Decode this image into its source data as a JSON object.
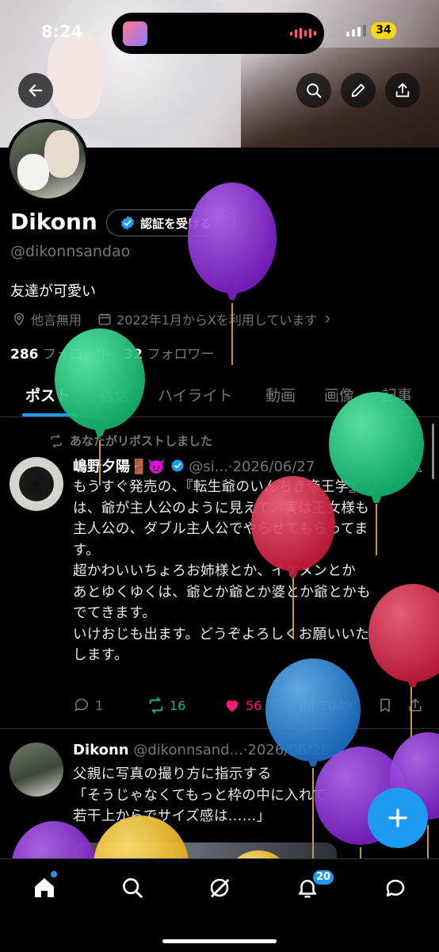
{
  "status_bar": {
    "time": "8:24",
    "battery": "34"
  },
  "profile": {
    "name": "Dikonn",
    "verify_label": "認証を受ける",
    "handle": "@dikonnsandao",
    "bio": "友達が可愛い",
    "location": "他言無用",
    "joined": "2022年1月からXを利用しています",
    "following_count": "286",
    "following_label": "フォロー中",
    "followers_count": "32",
    "followers_label": "フォロワー"
  },
  "tabs": [
    {
      "label": "ポスト"
    },
    {
      "label": "返信"
    },
    {
      "label": "ハイライト"
    },
    {
      "label": "動画"
    },
    {
      "label": "画像"
    },
    {
      "label": "記事"
    }
  ],
  "posts": [
    {
      "repost_text": "あなたがリポストしました",
      "author": "嶋野夕陽🚪👿",
      "handle": "@si...",
      "date": "·2026/06/27",
      "lines": [
        "もうすぐ発売の、『転生爺のいんちき帝王学』",
        "は、爺が主人公のように見えて、実は王女様も",
        "主人公の、ダブル主人公でやらせてもらってま",
        "す。",
        "超かわいいちょろお姉様とか、イケメンとか",
        "あとゆくゆくは、爺とか爺とか婆とか爺とかも",
        "でてきます。",
        "いけおじも出ます。どうぞよろしくお願いいた",
        "します。"
      ],
      "replies": "1",
      "reposts": "16",
      "likes": "56",
      "views": "3049"
    },
    {
      "author": "Dikonn",
      "handle": "@dikonnsand...",
      "date": "·2026/06/28",
      "lines": [
        "父親に写真の撮り方に指示する",
        "「そうじゃなくてもっと枠の中に入れて",
        "若干上からでサイズ感は......」"
      ]
    }
  ],
  "nav": {
    "notifications_badge": "20"
  },
  "colors": {
    "accent": "#1d9bf0",
    "like": "#f91880",
    "repost": "#00ba7c",
    "muted": "#71767b",
    "balloons": [
      "#8e2ed6",
      "#1fd184",
      "#e0304f",
      "#2f8fe0",
      "#f2c230"
    ]
  }
}
